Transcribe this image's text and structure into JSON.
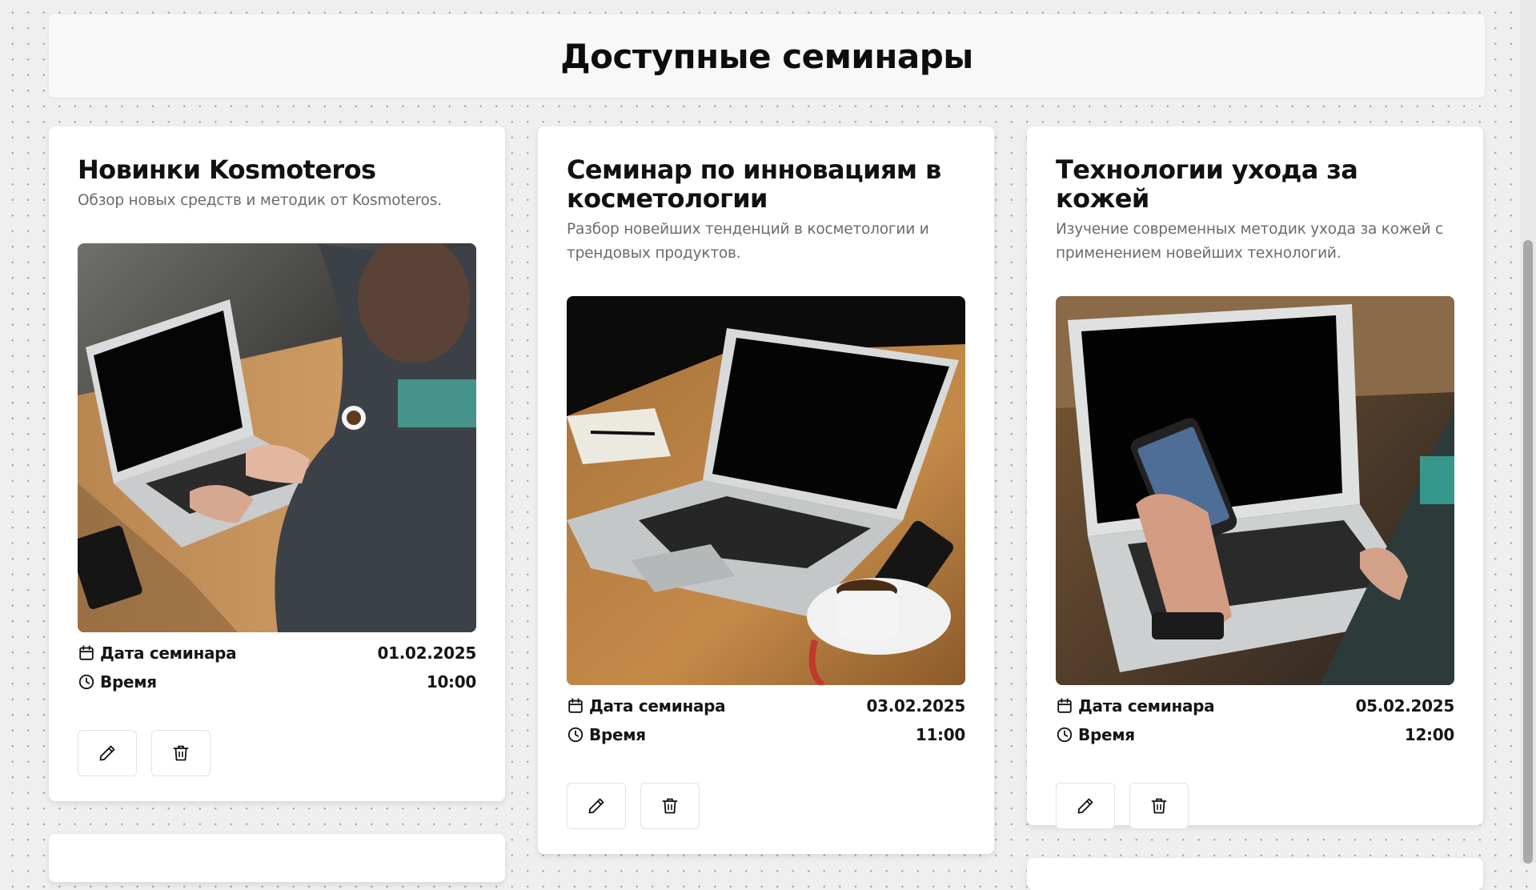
{
  "page": {
    "title": "Доступные семинары"
  },
  "labels": {
    "date": "Дата семинара",
    "time": "Время"
  },
  "icons": {
    "date": "calendar-icon",
    "time": "clock-icon",
    "edit": "pencil-icon",
    "delete": "trash-icon"
  },
  "seminars": [
    {
      "title": "Новинки Kosmoteros",
      "description": "Обзор новых средств и методик от Kosmoteros.",
      "date": "01.02.2025",
      "time": "10:00"
    },
    {
      "title": "Семинар по инновациям в косметологии",
      "description": "Разбор новейших тенденций в косметологии и трендовых продуктов.",
      "date": "03.02.2025",
      "time": "11:00"
    },
    {
      "title": "Технологии ухода за кожей",
      "description": "Изучение современных методик ухода за кожей с применением новейших технологий.",
      "date": "05.02.2025",
      "time": "12:00"
    }
  ]
}
